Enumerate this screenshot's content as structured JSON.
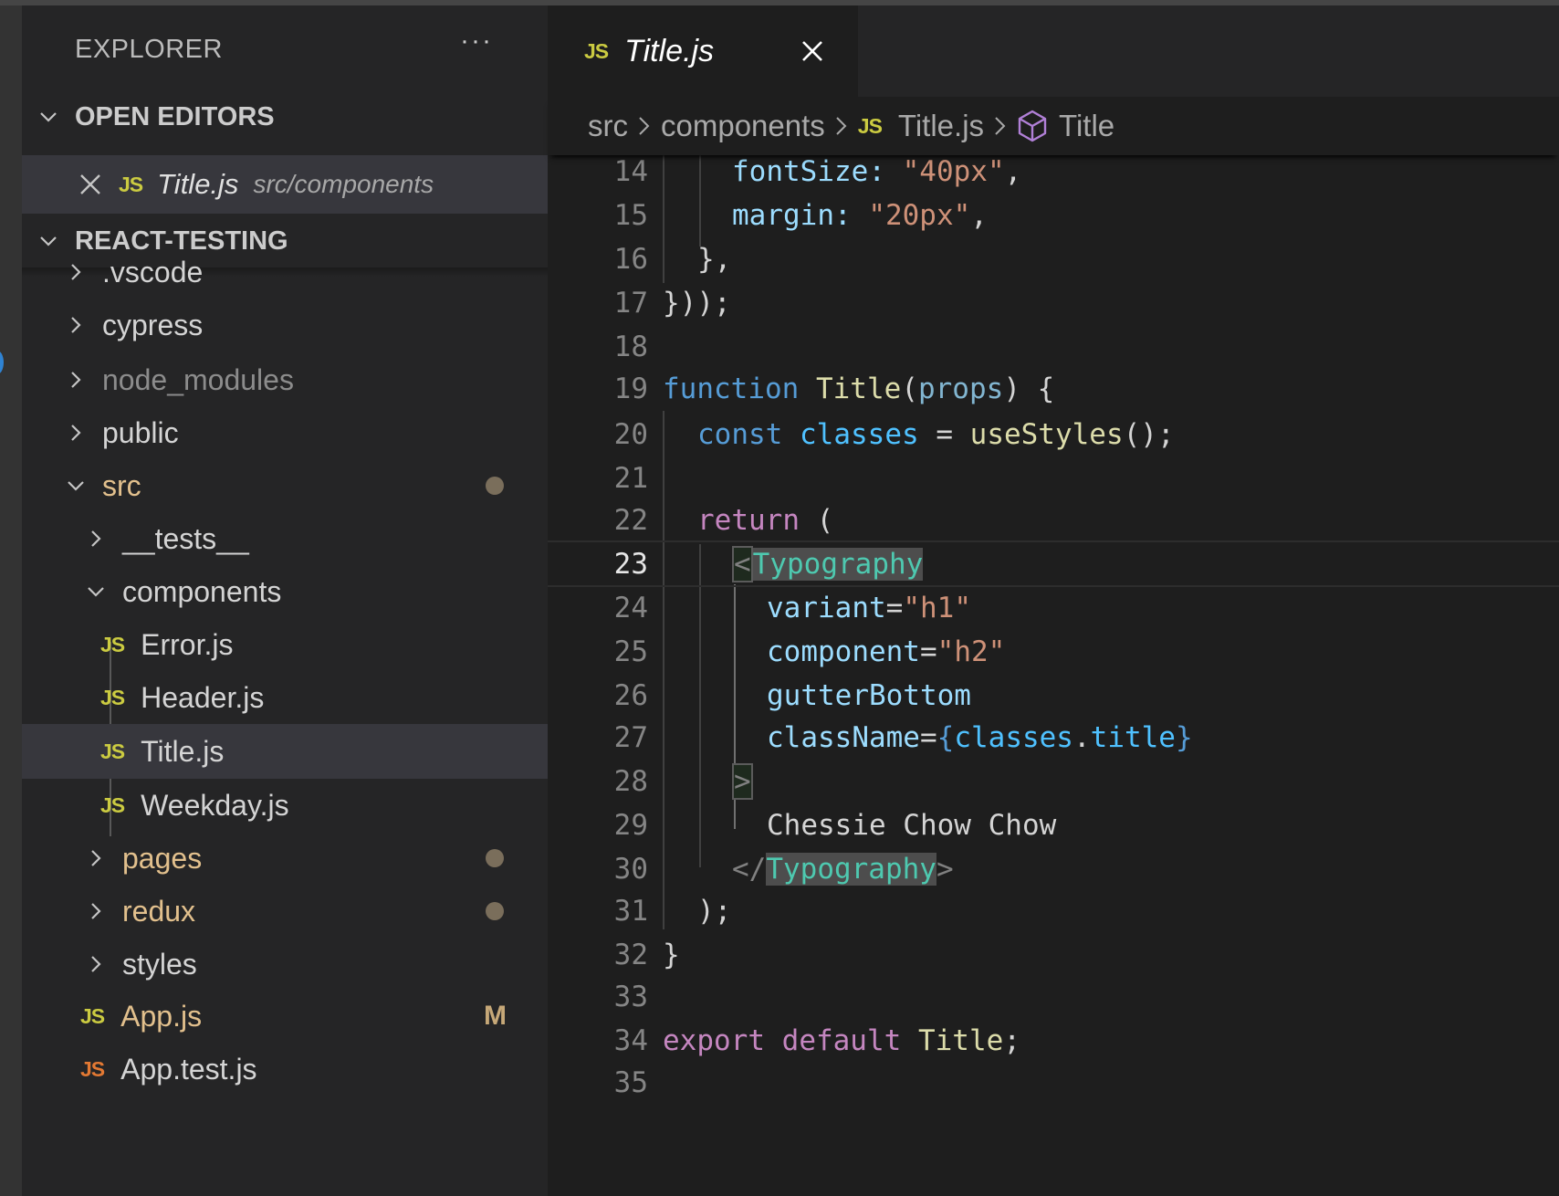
{
  "sidebar": {
    "title": "EXPLORER",
    "more_icon": "ellipsis-icon",
    "open_editors": {
      "label": "OPEN EDITORS",
      "items": [
        {
          "name": "Title.js",
          "path": "src/components",
          "icon": "js-file-icon"
        }
      ]
    },
    "project": {
      "label": "REACT-TESTING",
      "tree": [
        {
          "label": ".vscode",
          "type": "folder",
          "expanded": false,
          "depth": 0
        },
        {
          "label": "cypress",
          "type": "folder",
          "expanded": false,
          "depth": 0
        },
        {
          "label": "node_modules",
          "type": "folder",
          "expanded": false,
          "depth": 0,
          "dimmed": true
        },
        {
          "label": "public",
          "type": "folder",
          "expanded": false,
          "depth": 0
        },
        {
          "label": "src",
          "type": "folder",
          "expanded": true,
          "depth": 0,
          "modified": true,
          "badge": "dot"
        },
        {
          "label": "__tests__",
          "type": "folder",
          "expanded": false,
          "depth": 1
        },
        {
          "label": "components",
          "type": "folder",
          "expanded": true,
          "depth": 1
        },
        {
          "label": "Error.js",
          "type": "file",
          "depth": 2
        },
        {
          "label": "Header.js",
          "type": "file",
          "depth": 2
        },
        {
          "label": "Title.js",
          "type": "file",
          "depth": 2,
          "selected": true
        },
        {
          "label": "Weekday.js",
          "type": "file",
          "depth": 2
        },
        {
          "label": "pages",
          "type": "folder",
          "expanded": false,
          "depth": 1,
          "modified": true,
          "badge": "dot"
        },
        {
          "label": "redux",
          "type": "folder",
          "expanded": false,
          "depth": 1,
          "modified": true,
          "badge": "dot"
        },
        {
          "label": "styles",
          "type": "folder",
          "expanded": false,
          "depth": 1
        },
        {
          "label": "App.js",
          "type": "file",
          "depth": 1,
          "modified": true,
          "badge": "M"
        },
        {
          "label": "App.test.js",
          "type": "file",
          "depth": 1,
          "test": true
        }
      ]
    }
  },
  "editor": {
    "tabs": [
      {
        "label": "Title.js",
        "icon": "js-file-icon",
        "active": true
      }
    ],
    "breadcrumb": [
      {
        "label": "src"
      },
      {
        "label": "components"
      },
      {
        "label": "Title.js",
        "icon": "js-file-icon"
      },
      {
        "label": "Title",
        "icon": "symbol-class-icon"
      }
    ],
    "current_line": 23,
    "lines": [
      {
        "n": "14",
        "code": "fontSize: \"40px\","
      },
      {
        "n": "15",
        "code": "margin: \"20px\","
      },
      {
        "n": "16",
        "code": "},"
      },
      {
        "n": "17",
        "code": "}));"
      },
      {
        "n": "18",
        "code": ""
      },
      {
        "n": "19",
        "code": "function Title(props) {"
      },
      {
        "n": "20",
        "code": "const classes = useStyles();"
      },
      {
        "n": "21",
        "code": ""
      },
      {
        "n": "22",
        "code": "return ("
      },
      {
        "n": "23",
        "code": "<Typography"
      },
      {
        "n": "24",
        "code": "variant=\"h1\""
      },
      {
        "n": "25",
        "code": "component=\"h2\""
      },
      {
        "n": "26",
        "code": "gutterBottom"
      },
      {
        "n": "27",
        "code": "className={classes.title}"
      },
      {
        "n": "28",
        "code": ">"
      },
      {
        "n": "29",
        "code": "Chessie Chow Chow"
      },
      {
        "n": "30",
        "code": "</Typography>"
      },
      {
        "n": "31",
        "code": ");"
      },
      {
        "n": "32",
        "code": "}"
      },
      {
        "n": "33",
        "code": ""
      },
      {
        "n": "34",
        "code": "export default Title;"
      },
      {
        "n": "35",
        "code": ""
      }
    ],
    "tokens": {
      "l14_prop": "fontSize",
      "l14_colon": ": ",
      "l14_str": "\"40px\"",
      "l14_comma": ",",
      "l15_prop": "margin",
      "l15_colon": ": ",
      "l15_str": "\"20px\"",
      "l15_comma": ",",
      "l16": "},",
      "l17": "}));",
      "l19_kw": "function",
      "l19_fn": "Title",
      "l19_open": "(",
      "l19_param": "props",
      "l19_close": ") {",
      "l20_kw": "const",
      "l20_var": "classes",
      "l20_eq": " = ",
      "l20_fn": "useStyles",
      "l20_end": "();",
      "l22_kw": "return",
      "l22_paren": " (",
      "l23_lt": "<",
      "l23_tag": "Typography",
      "l24_attr": "variant",
      "l24_eq": "=",
      "l24_str": "\"h1\"",
      "l25_attr": "component",
      "l25_eq": "=",
      "l25_str": "\"h2\"",
      "l26_attr": "gutterBottom",
      "l27_attr": "className",
      "l27_eq": "=",
      "l27_ob": "{",
      "l27_var": "classes",
      "l27_dot": ".",
      "l27_prop": "title",
      "l27_cb": "}",
      "l28_gt": ">",
      "l29_text": "Chessie Chow Chow",
      "l30_lt": "</",
      "l30_tag": "Typography",
      "l30_gt": ">",
      "l31": ");",
      "l32": "}",
      "l34_kw1": "export",
      "l34_kw2": "default",
      "l34_fn": "Title",
      "l34_semi": ";"
    }
  },
  "colors": {
    "accent_blue": "#2f83d3",
    "js_icon": "#cbcb41",
    "js_test_icon": "#e37933",
    "git_modified": "#e2c08d",
    "symbol_class": "#b180d7"
  }
}
